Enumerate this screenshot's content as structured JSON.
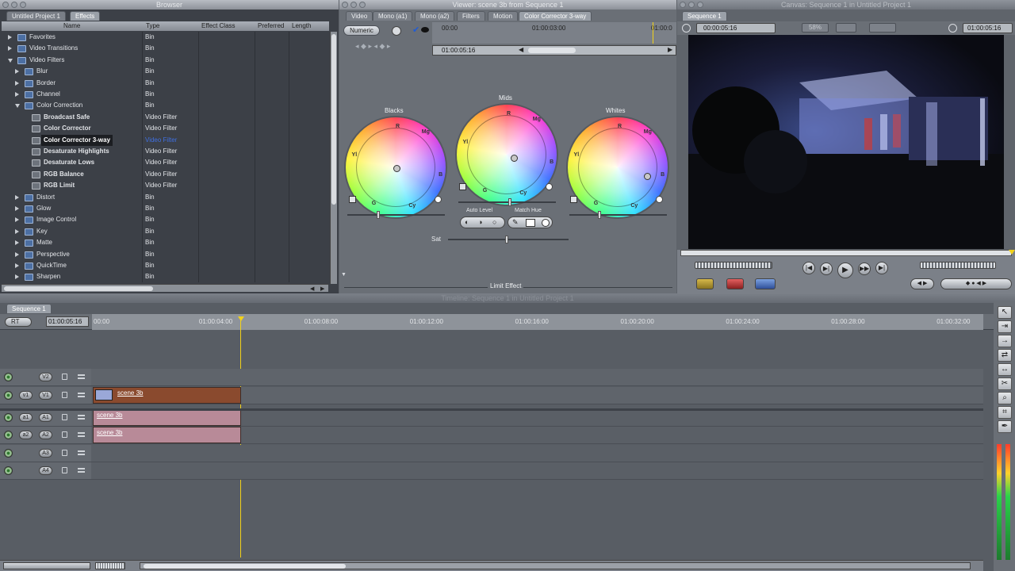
{
  "browser": {
    "window_title": "Browser",
    "tabs": [
      "Untitled Project 1",
      "Effects"
    ],
    "columns": [
      "Name",
      "Type",
      "Effect Class",
      "Preferred",
      "Length"
    ],
    "rows": [
      {
        "name": "Favorites",
        "type": "Bin",
        "level": 0,
        "disclosure": "closed",
        "icon": "bin-folder-icon"
      },
      {
        "name": "Video Transitions",
        "type": "Bin",
        "level": 0,
        "disclosure": "closed",
        "icon": "bin-folder-icon"
      },
      {
        "name": "Video Filters",
        "type": "Bin",
        "level": 0,
        "disclosure": "open",
        "icon": "bin-folder-icon"
      },
      {
        "name": "Blur",
        "type": "Bin",
        "level": 1,
        "disclosure": "closed",
        "icon": "bin-folder-icon"
      },
      {
        "name": "Border",
        "type": "Bin",
        "level": 1,
        "disclosure": "closed",
        "icon": "bin-folder-icon"
      },
      {
        "name": "Channel",
        "type": "Bin",
        "level": 1,
        "disclosure": "closed",
        "icon": "bin-folder-icon"
      },
      {
        "name": "Color Correction",
        "type": "Bin",
        "level": 1,
        "disclosure": "open",
        "icon": "bin-folder-icon"
      },
      {
        "name": "Broadcast Safe",
        "type": "Video Filter",
        "level": 2,
        "disclosure": "none",
        "icon": "filter-icon"
      },
      {
        "name": "Color Corrector",
        "type": "Video Filter",
        "level": 2,
        "disclosure": "none",
        "icon": "filter-icon"
      },
      {
        "name": "Color Corrector 3-way",
        "type": "Video Filter",
        "level": 2,
        "disclosure": "none",
        "icon": "filter-icon",
        "selected": true
      },
      {
        "name": "Desaturate Highlights",
        "type": "Video Filter",
        "level": 2,
        "disclosure": "none",
        "icon": "filter-icon"
      },
      {
        "name": "Desaturate Lows",
        "type": "Video Filter",
        "level": 2,
        "disclosure": "none",
        "icon": "filter-icon"
      },
      {
        "name": "RGB Balance",
        "type": "Video Filter",
        "level": 2,
        "disclosure": "none",
        "icon": "filter-icon"
      },
      {
        "name": "RGB Limit",
        "type": "Video Filter",
        "level": 2,
        "disclosure": "none",
        "icon": "filter-icon"
      },
      {
        "name": "Distort",
        "type": "Bin",
        "level": 1,
        "disclosure": "closed",
        "icon": "bin-folder-icon"
      },
      {
        "name": "Glow",
        "type": "Bin",
        "level": 1,
        "disclosure": "closed",
        "icon": "bin-folder-icon"
      },
      {
        "name": "Image Control",
        "type": "Bin",
        "level": 1,
        "disclosure": "closed",
        "icon": "bin-folder-icon"
      },
      {
        "name": "Key",
        "type": "Bin",
        "level": 1,
        "disclosure": "closed",
        "icon": "bin-folder-icon"
      },
      {
        "name": "Matte",
        "type": "Bin",
        "level": 1,
        "disclosure": "closed",
        "icon": "bin-folder-icon"
      },
      {
        "name": "Perspective",
        "type": "Bin",
        "level": 1,
        "disclosure": "closed",
        "icon": "bin-folder-icon"
      },
      {
        "name": "QuickTime",
        "type": "Bin",
        "level": 1,
        "disclosure": "closed",
        "icon": "bin-folder-icon"
      },
      {
        "name": "Sharpen",
        "type": "Bin",
        "level": 1,
        "disclosure": "closed",
        "icon": "bin-folder-icon"
      }
    ]
  },
  "viewer": {
    "window_title": "Viewer: scene 3b from Sequence 1",
    "tabs": [
      "Video",
      "Mono (a1)",
      "Mono (a2)",
      "Filters",
      "Motion",
      "Color Corrector 3-way"
    ],
    "numeric_label": "Numeric",
    "ruler_times": [
      "00:00",
      "01:00:03:00",
      "01:00:0"
    ],
    "current_time": "01:00:05:16",
    "wheels": [
      {
        "label": "Blacks",
        "puck": {
          "x": 0.0,
          "y": 0.0
        }
      },
      {
        "label": "Mids",
        "puck": {
          "x": 0.15,
          "y": -0.05
        }
      },
      {
        "label": "Whites",
        "puck": {
          "x": 0.65,
          "y": -0.18
        }
      }
    ],
    "wheel_letters": [
      "R",
      "Mg",
      "B",
      "Cy",
      "G",
      "Yl"
    ],
    "auto_level_label": "Auto Level",
    "match_hue_label": "Match Hue",
    "sat_label": "Sat",
    "limit_effect_label": "Limit Effect"
  },
  "canvas": {
    "window_title": "Canvas: Sequence 1 in Untitled Project 1",
    "tab": "Sequence 1",
    "timecode_left": "00:00:05:16",
    "zoom": "58%",
    "timecode_right": "01:00:05:16"
  },
  "timeline": {
    "window_title": "Timeline: Sequence 1 in Untitled Project 1",
    "tab": "Sequence 1",
    "rt_label": "RT",
    "current_time": "01:00:05:16",
    "ruler": [
      "00:00",
      "01:00:04:00",
      "01:00:08:00",
      "01:00:12:00",
      "01:00:16:00",
      "01:00:20:00",
      "01:00:24:00",
      "01:00:28:00",
      "01:00:32:00"
    ],
    "tracks": [
      {
        "dest": "",
        "name": "V2",
        "clip": ""
      },
      {
        "dest": "v1",
        "name": "V1",
        "clip": "scene 3b"
      },
      {
        "dest": "a1",
        "name": "A1",
        "clip": "scene 3b"
      },
      {
        "dest": "a2",
        "name": "A2",
        "clip": "scene 3b"
      },
      {
        "dest": "",
        "name": "A3",
        "clip": ""
      },
      {
        "dest": "",
        "name": "A4",
        "clip": ""
      }
    ]
  },
  "colors": {
    "video_clip": "#8a4a2e",
    "audio_clip": "#b88a98",
    "selection": "#1c1e22",
    "playhead": "#f2d21a"
  }
}
